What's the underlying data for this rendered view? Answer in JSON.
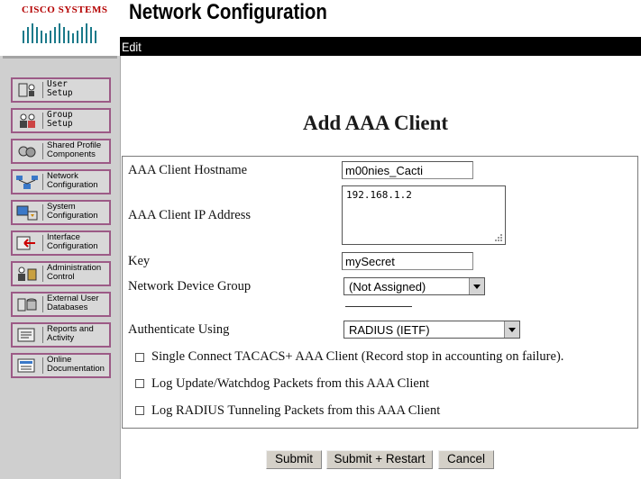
{
  "brand": {
    "name": "CISCO SYSTEMS"
  },
  "header": {
    "title": "Network Configuration",
    "section": "Edit"
  },
  "sidebar": {
    "items": [
      {
        "label": "User\nSetup",
        "icon": "user-setup-icon"
      },
      {
        "label": "Group\nSetup",
        "icon": "group-setup-icon"
      },
      {
        "label": "Shared Profile\nComponents",
        "icon": "shared-profile-icon"
      },
      {
        "label": "Network\nConfiguration",
        "icon": "network-config-icon"
      },
      {
        "label": "System\nConfiguration",
        "icon": "system-config-icon"
      },
      {
        "label": "Interface\nConfiguration",
        "icon": "interface-config-icon"
      },
      {
        "label": "Administration\nControl",
        "icon": "admin-control-icon"
      },
      {
        "label": "External User\nDatabases",
        "icon": "external-db-icon"
      },
      {
        "label": "Reports and\nActivity",
        "icon": "reports-icon"
      },
      {
        "label": "Online\nDocumentation",
        "icon": "docs-icon"
      }
    ]
  },
  "form": {
    "title": "Add AAA Client",
    "hostname": {
      "label": "AAA Client Hostname",
      "value": "m00nies_Cacti"
    },
    "ip": {
      "label": "AAA Client IP Address",
      "value": "192.168.1.2"
    },
    "key": {
      "label": "Key",
      "value": "mySecret"
    },
    "ndg": {
      "label": "Network Device Group",
      "value": "(Not Assigned)"
    },
    "auth": {
      "label": "Authenticate Using",
      "value": "RADIUS (IETF)"
    },
    "checkboxes": [
      {
        "label": "Single Connect TACACS+ AAA Client (Record stop in accounting on failure).",
        "checked": false
      },
      {
        "label": "Log Update/Watchdog Packets from this AAA Client",
        "checked": false
      },
      {
        "label": "Log RADIUS Tunneling Packets from this AAA Client",
        "checked": false
      }
    ]
  },
  "buttons": {
    "submit": "Submit",
    "submit_restart": "Submit + Restart",
    "cancel": "Cancel"
  },
  "colors": {
    "nav_border": "#9c5a86",
    "brand_red": "#b40000",
    "sidebar_bg": "#cfcfcf"
  }
}
